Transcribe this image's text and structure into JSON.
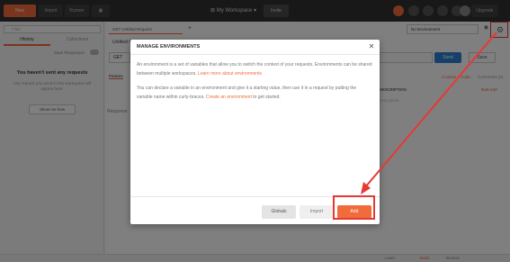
{
  "header": {
    "new_label": "New",
    "import_label": "Import",
    "runner_label": "Runner",
    "workspace_label": "My Workspace",
    "invite_label": "Invite",
    "upgrade_label": "Upgrade"
  },
  "sidebar": {
    "filter_placeholder": "Filter",
    "tab_history": "History",
    "tab_collections": "Collections",
    "save_responses": "Save Responses",
    "empty_heading": "You haven't sent any requests",
    "empty_text": "Any request you send in this workspace will appear here.",
    "show_me_label": "Show me how"
  },
  "main": {
    "request_tab": "GET Untitled Request",
    "untitled_label": "Untitled Request",
    "environment_select": "No Environment",
    "method": "GET",
    "send_label": "Send",
    "save_label": "Save",
    "params_tab": "Params",
    "cookies_label": "Cookies",
    "code_label": "Code",
    "comments_label": "Comments (0)",
    "description_column": "DESCRIPTION",
    "bulk_edit_label": "Bulk Edit",
    "description_placeholder": "Description",
    "response_label": "Response"
  },
  "modal": {
    "title": "MANAGE ENVIRONMENTS",
    "paragraph1": "An environment is a set of variables that allow you to switch the context of your requests. Environments can be shared between multiple workspaces.",
    "paragraph1_link": "Learn more about environments",
    "paragraph2": "You can declare a variable in an environment and give it a starting value, then use it in a request by putting the variable name within curly-braces.",
    "paragraph2_link": "Create an environment",
    "paragraph2_suffix": "to get started.",
    "globals_label": "Globals",
    "import_label": "Import",
    "add_label": "Add"
  },
  "statusbar": {
    "learn_label": "Learn",
    "build_label": "Build",
    "browse_label": "Browse"
  },
  "colors": {
    "accent": "#f26b3a",
    "send": "#2f80d1",
    "annotation": "#e53935"
  }
}
